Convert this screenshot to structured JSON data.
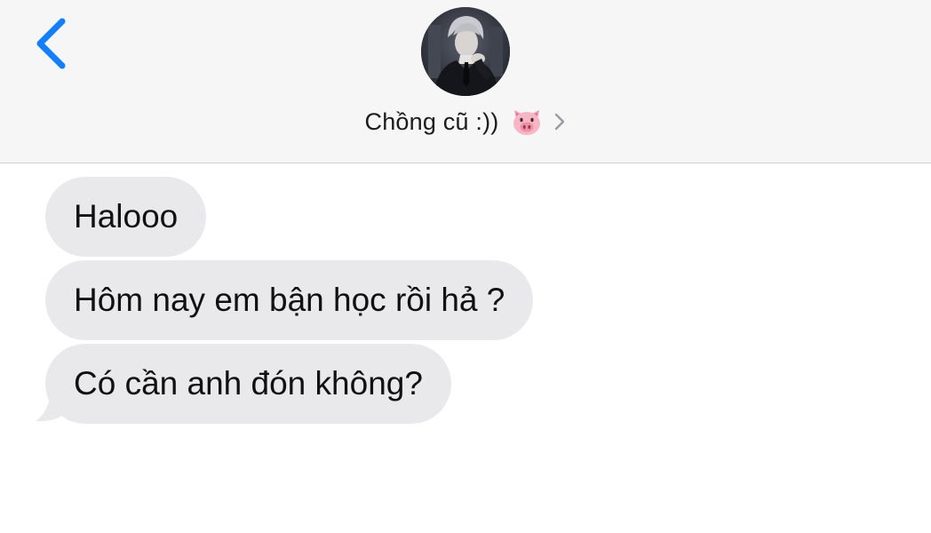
{
  "header": {
    "back_icon": "chevron-left-icon",
    "contact_name": "Chồng cũ :))",
    "contact_emoji": "pig-face-icon",
    "detail_icon": "chevron-right-icon",
    "avatar_icon": "contact-avatar-photo"
  },
  "messages": [
    {
      "text": "Halooo",
      "direction": "incoming"
    },
    {
      "text": "Hôm nay em bận học rồi hả ?",
      "direction": "incoming"
    },
    {
      "text": "Có cần anh đón không?",
      "direction": "incoming"
    }
  ],
  "colors": {
    "accent": "#147efb",
    "header_bg": "#f6f6f6",
    "incoming_bubble": "#e9e9eb",
    "text": "#111111"
  }
}
